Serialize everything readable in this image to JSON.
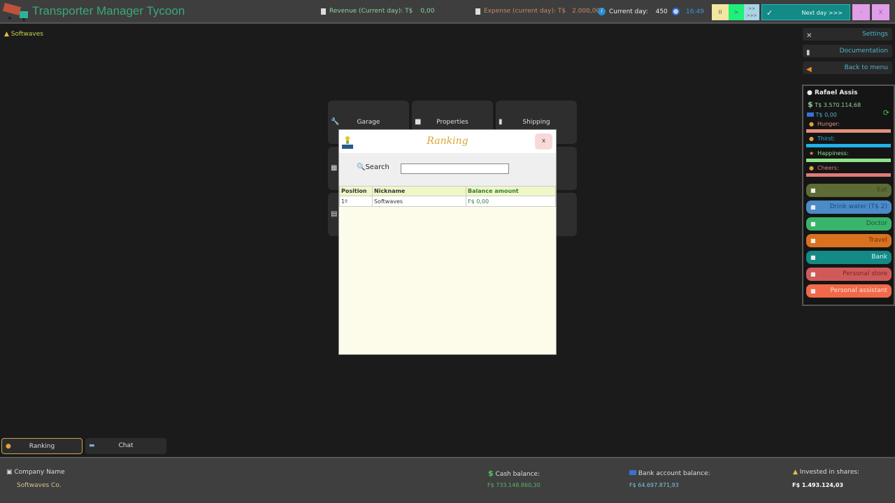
{
  "header": {
    "title": "Transporter Manager Tycoon",
    "revenue_label": "Revenue (Current day): T$",
    "revenue_value": "0,00",
    "expense_label": "Expense (current day): T$",
    "expense_value": "2.000,00",
    "day_label": "Current day:",
    "day_value": "450",
    "time": "16:49",
    "pause": "II",
    "play": ">",
    "fast": ">> >>>",
    "next_day": "Next day >>>",
    "check": "✓",
    "minimize": "-",
    "close": "X"
  },
  "user": {
    "name": "Softwaves"
  },
  "right_menu": {
    "settings": "Settings",
    "documentation": "Documentation",
    "back": "Back to menu"
  },
  "player": {
    "name": "Rafael Assis",
    "cash": "T$  3.570.114,68",
    "bank": "T$  0,00",
    "needs": [
      {
        "label": "Hunger:",
        "color": "#e2907a",
        "level": 100
      },
      {
        "label": "Thirst:",
        "color": "#1fb1e8",
        "level": 100
      },
      {
        "label": "Happiness:",
        "color": "#8fe38a",
        "level": 100
      },
      {
        "label": "Cheers:",
        "color": "#e07a7a",
        "level": 100
      }
    ],
    "actions": [
      {
        "label": "Eat",
        "color": "#5d6b35",
        "text": "#3c4520"
      },
      {
        "label": "Drink water (T$ 2)",
        "color": "#4a8bc8",
        "text": "#1f4a7a"
      },
      {
        "label": "Doctor",
        "color": "#39b46a",
        "text": "#1c5a34"
      },
      {
        "label": "Travel",
        "color": "#d9711f",
        "text": "#6b3510"
      },
      {
        "label": "Bank",
        "color": "#138a86",
        "text": "#d8f5f4"
      },
      {
        "label": "Personal store",
        "color": "#d05a5a",
        "text": "#7a2424"
      },
      {
        "label": "Personal assistant",
        "color": "#f06a4a",
        "text": "#ffe0d6"
      }
    ]
  },
  "tiles": [
    "Garage",
    "Properties",
    "Shipping"
  ],
  "modal": {
    "title": "Ranking",
    "close": "x",
    "search_label": "Search",
    "search_value": "",
    "columns": [
      "Position",
      "Nickname",
      "Balance amount"
    ],
    "rows": [
      [
        "1º",
        "Softwaves",
        "F$  0,00"
      ]
    ]
  },
  "bottom_tabs": [
    "Ranking",
    "Chat"
  ],
  "footer": {
    "company_label": "Company Name",
    "company_value": "Softwaves Co.",
    "cash_label": "Cash balance:",
    "cash_value": "F$  733.148.860,30",
    "bank_label": "Bank account balance:",
    "bank_value": "F$  64.697.871,93",
    "shares_label": "Invested in shares:",
    "shares_value": "F$  1.493.124,03"
  }
}
